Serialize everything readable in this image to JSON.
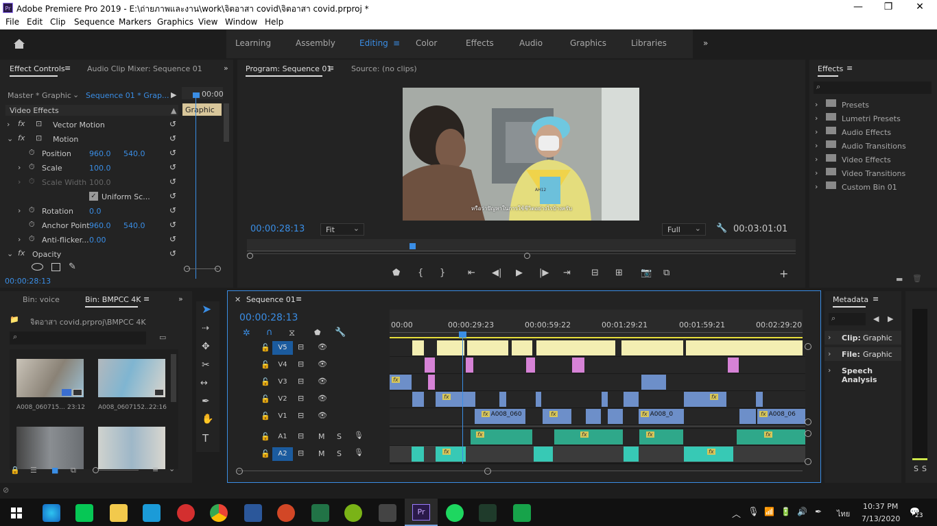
{
  "app": {
    "title": "Adobe Premiere Pro 2019 - E:\\ถ่ายภาพและงาน\\work\\จิตอาสา covid\\จิตอาสา covid.prproj *",
    "logo": "Pr"
  },
  "menu": [
    "File",
    "Edit",
    "Clip",
    "Sequence",
    "Markers",
    "Graphics",
    "View",
    "Window",
    "Help"
  ],
  "workspaces": [
    "Learning",
    "Assembly",
    "Editing",
    "Color",
    "Effects",
    "Audio",
    "Graphics",
    "Libraries"
  ],
  "active_workspace": "Editing",
  "effect_controls": {
    "tab": "Effect Controls",
    "tab2": "Audio Clip Mixer: Sequence 01",
    "master": "Master * Graphic",
    "sequence": "Sequence 01 * Grap...",
    "timecode_top": "00:00",
    "graphic_clip": "Graphic",
    "section": "Video Effects",
    "rows": [
      {
        "label": "Vector Motion",
        "type": "fx"
      },
      {
        "label": "Motion",
        "type": "fx"
      },
      {
        "label": "Position",
        "v1": "960.0",
        "v2": "540.0"
      },
      {
        "label": "Scale",
        "v1": "100.0"
      },
      {
        "label": "Scale Width",
        "v1": "100.0",
        "disabled": true
      },
      {
        "label": "Uniform Sc...",
        "checkbox": true
      },
      {
        "label": "Rotation",
        "v1": "0.0"
      },
      {
        "label": "Anchor Point",
        "v1": "960.0",
        "v2": "540.0"
      },
      {
        "label": "Anti-flicker...",
        "v1": "0.00"
      },
      {
        "label": "Opacity",
        "type": "fx"
      }
    ],
    "timecode": "00:00:28:13"
  },
  "program": {
    "tab": "Program: Sequence 01",
    "tab2": "Source: (no clips)",
    "timecode": "00:00:28:13",
    "fit": "Fit",
    "quality": "Full",
    "duration": "00:03:01:01",
    "subtitle": "หรือว่าปัญหาในการใช้ชีวิตอย่างไรบ้างครับ",
    "patch": "AH12"
  },
  "effects": {
    "tab": "Effects",
    "items": [
      "Presets",
      "Lumetri Presets",
      "Audio Effects",
      "Audio Transitions",
      "Video Effects",
      "Video Transitions",
      "Custom Bin 01"
    ]
  },
  "project": {
    "tab1": "Bin: voice",
    "tab2": "Bin: BMPCC 4K",
    "path": "จิตอาสา covid.prproj\\BMPCC 4K",
    "clips": [
      {
        "name": "A008_060715...",
        "dur": "23:12"
      },
      {
        "name": "A008_0607152...",
        "dur": "22:16"
      }
    ]
  },
  "timeline": {
    "tab": "Sequence 01",
    "timecode": "00:00:28:13",
    "ruler": [
      "00:00",
      "00:00:29:23",
      "00:00:59:22",
      "00:01:29:21",
      "00:01:59:21",
      "00:02:29:20"
    ],
    "tracks": [
      "V5",
      "V4",
      "V3",
      "V2",
      "V1",
      "A1",
      "A2"
    ],
    "clip_labels": [
      "A008_060",
      "A008_0",
      "A008_06"
    ],
    "fx": "fx",
    "m": "M",
    "s": "S"
  },
  "metadata": {
    "tab": "Metadata",
    "clip_label": "Clip:",
    "clip": "Graphic",
    "file_label": "File:",
    "file": "Graphic",
    "speech": "Speech Analysis"
  },
  "meter": {
    "s1": "S",
    "s2": "S"
  },
  "taskbar": {
    "time": "10:37 PM",
    "date": "7/13/2020",
    "lang": "ไทย",
    "notif": "23"
  }
}
